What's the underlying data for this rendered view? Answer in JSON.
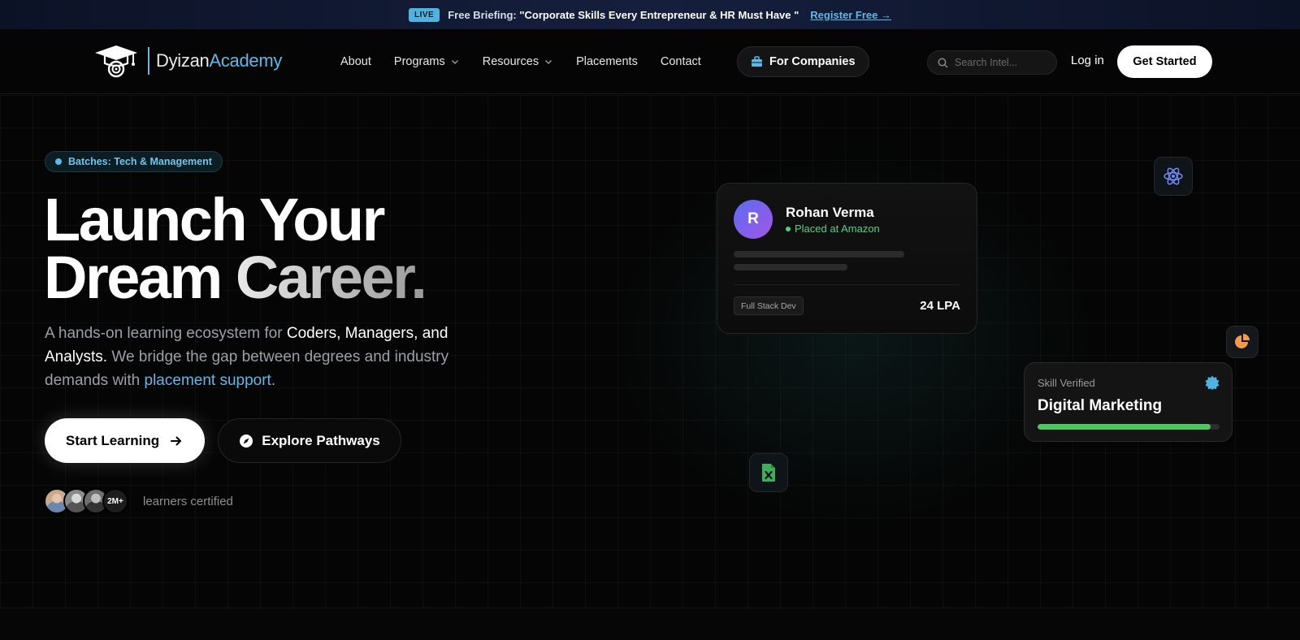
{
  "announcement": {
    "badge": "LIVE",
    "prefix": "Free Briefing:",
    "headline": "\"Corporate Skills Every Entrepreneur & HR Must Have \"",
    "cta": "Register Free →"
  },
  "nav": {
    "brand_part1": "Dyizan",
    "brand_part2": "Academy",
    "links": [
      "About",
      "Programs",
      "Resources",
      "Placements",
      "Contact"
    ],
    "for_companies": "For Companies",
    "search_placeholder": "Search Intel...",
    "login": "Log in",
    "get_started": "Get Started"
  },
  "hero": {
    "pill": "Batches: Tech & Management",
    "headline_line1": "Launch Your",
    "headline_line2a": "Dream",
    "headline_line2b": "Career.",
    "desc_1": "A hands-on learning ecosystem for ",
    "desc_2": "Coders, Managers, and Analysts.",
    "desc_3": " We bridge the gap between degrees and industry demands with ",
    "desc_4": "placement support.",
    "start_button": "Start Learning",
    "explore_button": "Explore Pathways",
    "learners_count": "2M+",
    "learners_text": "learners certified"
  },
  "placement_card": {
    "initial": "R",
    "name": "Rohan Verma",
    "status": "Placed at Amazon",
    "role": "Full Stack Dev",
    "salary": "24 LPA"
  },
  "skill_card": {
    "label": "Skill Verified",
    "title": "Digital Marketing",
    "progress": 0.95
  },
  "colors": {
    "accent": "#5fb8e6",
    "success": "#4fd08a",
    "progress": "#4fc463"
  },
  "icons": [
    "graduation-cap-icon",
    "chevron-down-icon",
    "briefcase-icon",
    "search-icon",
    "arrow-right-icon",
    "compass-icon",
    "react-atom-icon",
    "pie-chart-icon",
    "excel-file-icon",
    "verified-badge-icon"
  ]
}
